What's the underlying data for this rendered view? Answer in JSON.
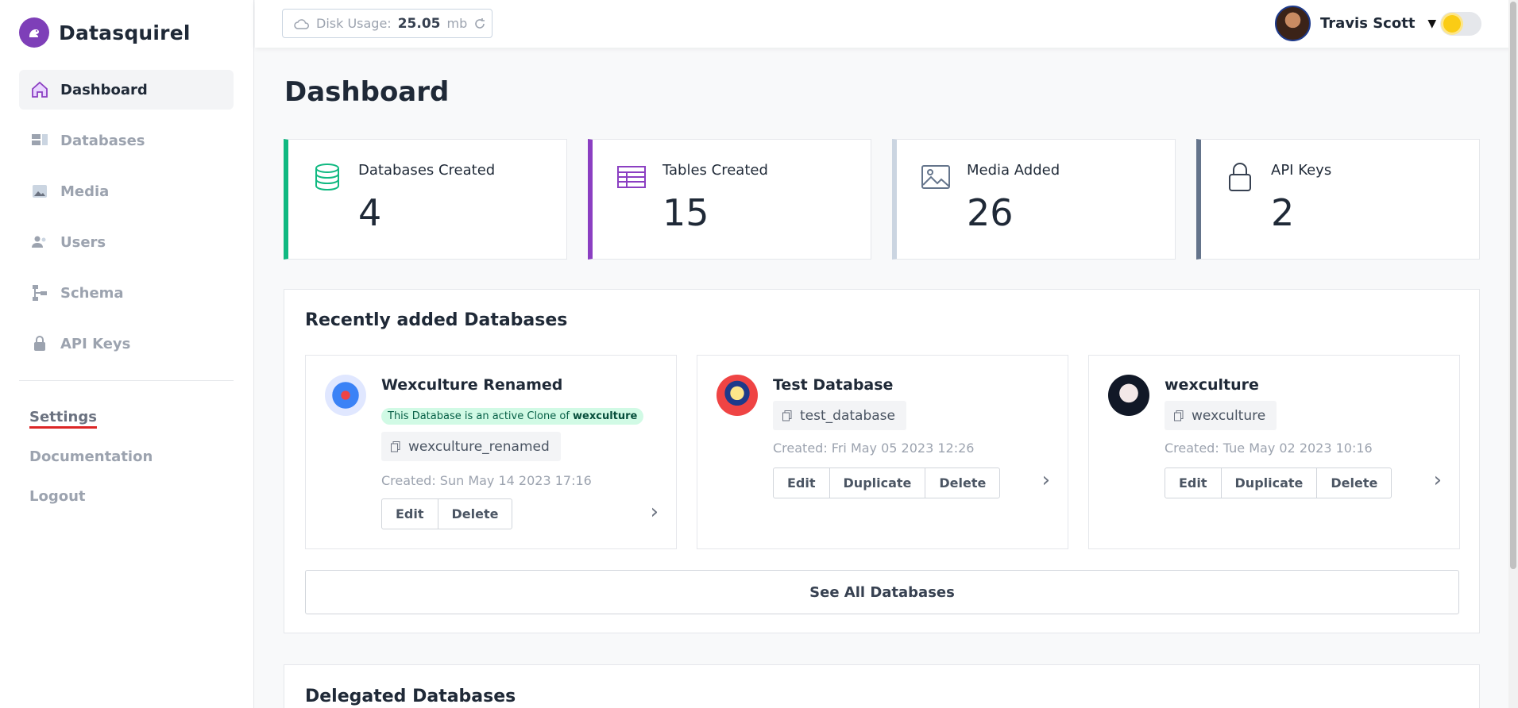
{
  "brand": {
    "name": "Datasquirel"
  },
  "sidebar": {
    "items": [
      {
        "label": "Dashboard",
        "icon": "home-icon",
        "active": true
      },
      {
        "label": "Databases",
        "icon": "database-icon"
      },
      {
        "label": "Media",
        "icon": "image-icon"
      },
      {
        "label": "Users",
        "icon": "users-icon"
      },
      {
        "label": "Schema",
        "icon": "schema-icon"
      },
      {
        "label": "API Keys",
        "icon": "lock-icon"
      }
    ],
    "links": {
      "settings": "Settings",
      "documentation": "Documentation",
      "logout": "Logout"
    }
  },
  "topbar": {
    "disk_label": "Disk Usage:",
    "disk_value": "25.05",
    "disk_unit": "mb",
    "user_name": "Travis Scott"
  },
  "page": {
    "title": "Dashboard"
  },
  "stats": [
    {
      "label": "Databases Created",
      "value": "4",
      "color": "#10b981"
    },
    {
      "label": "Tables Created",
      "value": "15",
      "color": "#8b3fc2"
    },
    {
      "label": "Media Added",
      "value": "26",
      "color": "#cbd5e1"
    },
    {
      "label": "API Keys",
      "value": "2",
      "color": "#64748b"
    }
  ],
  "recent": {
    "title": "Recently added Databases",
    "cards": [
      {
        "name": "Wexculture Renamed",
        "clone_prefix": "This Database is an active Clone of",
        "clone_of": "wexculture",
        "slug": "wexculture_renamed",
        "created": "Created: Sun May 14 2023 17:16",
        "buttons": [
          "Edit",
          "Delete"
        ]
      },
      {
        "name": "Test Database",
        "slug": "test_database",
        "created": "Created: Fri May 05 2023 12:26",
        "buttons": [
          "Edit",
          "Duplicate",
          "Delete"
        ]
      },
      {
        "name": "wexculture",
        "slug": "wexculture",
        "created": "Created: Tue May 02 2023 10:16",
        "buttons": [
          "Edit",
          "Duplicate",
          "Delete"
        ]
      }
    ],
    "see_all": "See All Databases"
  },
  "delegated": {
    "title": "Delegated Databases"
  }
}
